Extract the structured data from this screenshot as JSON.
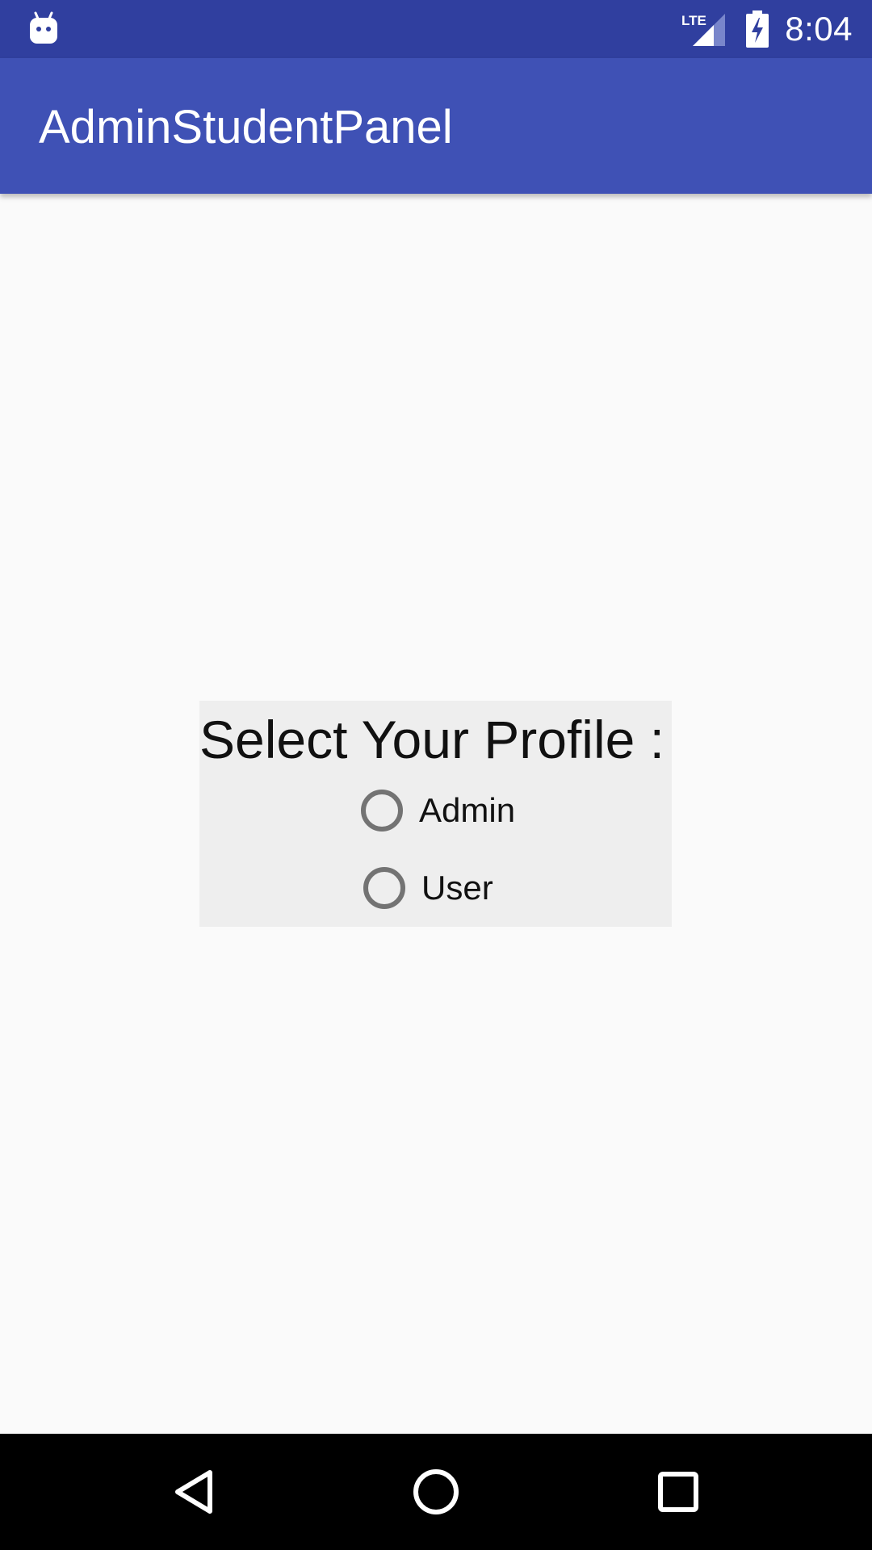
{
  "status_bar": {
    "time": "8:04",
    "network_label": "LTE",
    "icons": [
      "android-debug-icon",
      "lte-signal-icon",
      "battery-charging-icon"
    ],
    "background_color": "#303f9f"
  },
  "app_bar": {
    "title": "AdminStudentPanel",
    "background_color": "#3f51b5"
  },
  "profile_selector": {
    "heading": "Select Your Profile :",
    "options": [
      {
        "label": "Admin",
        "checked": false
      },
      {
        "label": "User",
        "checked": false
      }
    ],
    "background_color": "#eeeeee"
  },
  "nav_bar": {
    "buttons": [
      "back-icon",
      "home-icon",
      "recents-icon"
    ]
  }
}
